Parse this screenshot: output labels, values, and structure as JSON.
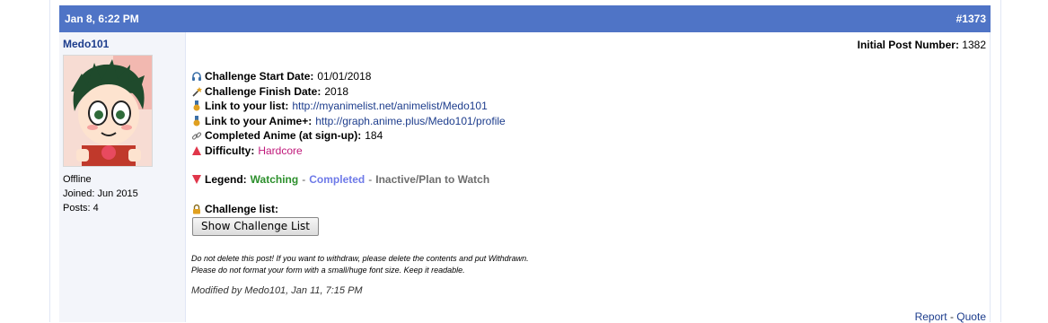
{
  "post": {
    "date": "Jan 8, 6:22 PM",
    "number": "#1373",
    "initial_label": "Initial Post Number:",
    "initial_value": "1382"
  },
  "user": {
    "name": "Medo101",
    "status": "Offline",
    "joined": "Joined: Jun 2015",
    "posts": "Posts: 4"
  },
  "fields": {
    "start_label": "Challenge Start Date:",
    "start_value": "01/01/2018",
    "finish_label": "Challenge Finish Date:",
    "finish_value": "2018",
    "list_label": "Link to your list:",
    "list_value": "http://myanimelist.net/animelist/Medo101",
    "animeplus_label": "Link to your Anime+:",
    "animeplus_value": "http://graph.anime.plus/Medo101/profile",
    "completed_label": "Completed Anime (at sign-up):",
    "completed_value": "184",
    "difficulty_label": "Difficulty:",
    "difficulty_value": "Hardcore"
  },
  "legend": {
    "label": "Legend:",
    "watching": "Watching",
    "completed": "Completed",
    "inactive": "Inactive/Plan to Watch",
    "sep": "-"
  },
  "challenge": {
    "label": "Challenge list:",
    "button": "Show Challenge List"
  },
  "notes": {
    "line1": "Do not delete this post! If you want to withdraw, please delete the contents and put Withdrawn.",
    "line2": "Please do not format your form with a small/huge font size. Keep it readable."
  },
  "modified": "Modified by Medo101, Jan 11, 7:15 PM",
  "actions": {
    "report": "Report",
    "sep": "-",
    "quote": "Quote"
  },
  "colors": {
    "header": "#4f74c6",
    "link": "#1c3c8c",
    "watching": "#2c8f2c",
    "completed": "#6e7ae8",
    "hardcore": "#c0187a"
  },
  "icons": [
    "headphones-icon",
    "wand-icon",
    "medal-icon",
    "medal-icon",
    "link-icon",
    "red-up-triangle-icon",
    "red-down-triangle-icon",
    "lock-icon"
  ]
}
